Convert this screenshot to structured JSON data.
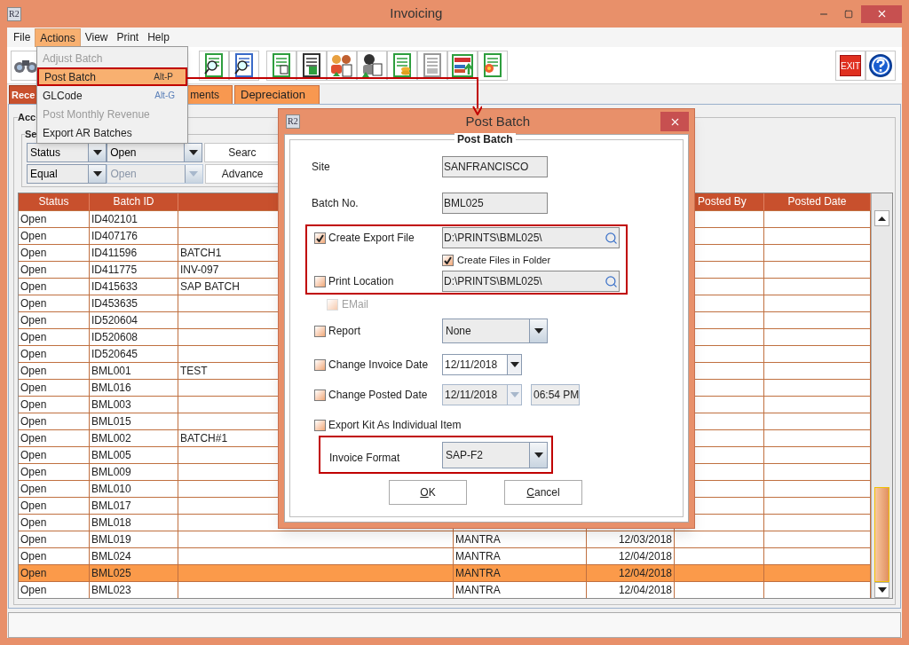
{
  "window": {
    "logo": "R2",
    "title": "Invoicing"
  },
  "menu_bar": [
    {
      "label": "File",
      "selected": false
    },
    {
      "label": "Actions",
      "selected": true
    },
    {
      "label": "View",
      "selected": false
    },
    {
      "label": "Print",
      "selected": false
    },
    {
      "label": "Help",
      "selected": false
    }
  ],
  "actions_menu": [
    {
      "label": "Adjust Batch",
      "disabled": true,
      "selected": false
    },
    {
      "label": "Post Batch",
      "shortcut": "Alt-P",
      "disabled": false,
      "selected": true
    },
    {
      "label": "GLCode",
      "shortcut": "Alt-G",
      "disabled": false,
      "selected": false
    },
    {
      "label": "Post Monthly Revenue",
      "disabled": true,
      "selected": false
    },
    {
      "label": "Export AR Batches",
      "disabled": false,
      "selected": false
    }
  ],
  "toolbar": {
    "exit_label": "EXIT"
  },
  "tabs": [
    {
      "label": "Rece",
      "selected": true
    },
    {
      "label": "ments",
      "selected": false
    },
    {
      "label": "Depreciation",
      "selected": false
    }
  ],
  "group_title": "Acc",
  "search_group": {
    "title": "Se",
    "field": "Status",
    "value": "Open",
    "operator": "Equal",
    "value_2": "Open",
    "value_2_disabled": true,
    "search_button": "Searc",
    "advanced_button": "Advance"
  },
  "table": {
    "header": {
      "status": "Status",
      "batch_id": "Batch ID",
      "posted_by": "Posted By",
      "posted_date": "Posted Date"
    },
    "rows": [
      {
        "status": "Open",
        "batch_id": "ID402101",
        "selected": false
      },
      {
        "status": "Open",
        "batch_id": "ID407176",
        "selected": false
      },
      {
        "status": "Open",
        "batch_id": "ID411596",
        "column_3": "BATCH1",
        "selected": false
      },
      {
        "status": "Open",
        "batch_id": "ID411775",
        "column_3": "INV-097",
        "selected": false
      },
      {
        "status": "Open",
        "batch_id": "ID415633",
        "column_3": "SAP BATCH",
        "selected": false
      },
      {
        "status": "Open",
        "batch_id": "ID453635",
        "selected": false
      },
      {
        "status": "Open",
        "batch_id": "ID520604",
        "selected": false
      },
      {
        "status": "Open",
        "batch_id": "ID520608",
        "selected": false
      },
      {
        "status": "Open",
        "batch_id": "ID520645",
        "selected": false
      },
      {
        "status": "Open",
        "batch_id": "BML001",
        "column_3": "TEST",
        "selected": false
      },
      {
        "status": "Open",
        "batch_id": "BML016",
        "selected": false
      },
      {
        "status": "Open",
        "batch_id": "BML003",
        "selected": false
      },
      {
        "status": "Open",
        "batch_id": "BML015",
        "selected": false
      },
      {
        "status": "Open",
        "batch_id": "BML002",
        "column_3": "BATCH#1",
        "selected": false
      },
      {
        "status": "Open",
        "batch_id": "BML005",
        "selected": false
      },
      {
        "status": "Open",
        "batch_id": "BML009",
        "selected": false
      },
      {
        "status": "Open",
        "batch_id": "BML010",
        "selected": false
      },
      {
        "status": "Open",
        "batch_id": "BML017",
        "selected": false
      },
      {
        "status": "Open",
        "batch_id": "BML018",
        "selected": false
      },
      {
        "status": "Open",
        "batch_id": "BML019",
        "column_4": "MANTRA",
        "column_5": "12/03/2018",
        "selected": false
      },
      {
        "status": "Open",
        "batch_id": "BML024",
        "column_4": "MANTRA",
        "column_5": "12/04/2018",
        "selected": false
      },
      {
        "status": "Open",
        "batch_id": "BML025",
        "column_4": "MANTRA",
        "column_5": "12/04/2018",
        "selected": true
      },
      {
        "status": "Open",
        "batch_id": "BML023",
        "column_4": "MANTRA",
        "column_5": "12/04/2018",
        "selected": false
      }
    ]
  },
  "dialog": {
    "logo": "R2",
    "title": "Post Batch",
    "group_title": "Post Batch",
    "site": {
      "label": "Site",
      "value": "SANFRANCISCO"
    },
    "batch_no": {
      "label": "Batch No.",
      "value": "BML025"
    },
    "export_highlighted": true,
    "create_export_file": {
      "label": "Create Export File",
      "checked": true,
      "path": "D:\\PRINTS\\BML025\\"
    },
    "create_files_in_folder": {
      "label": "Create Files in Folder",
      "checked": true
    },
    "print_location": {
      "label": "Print Location",
      "checked": false,
      "path": "D:\\PRINTS\\BML025\\"
    },
    "email": {
      "label": "EMail",
      "checked": false,
      "disabled": true
    },
    "report": {
      "label": "Report",
      "checked": false,
      "value": "None"
    },
    "change_invoice_date": {
      "label": "Change Invoice Date",
      "checked": false,
      "value": "12/11/2018",
      "disabled": false
    },
    "change_posted_date": {
      "label": "Change Posted Date",
      "checked": false,
      "value": "12/11/2018",
      "time": "06:54 PM",
      "disabled": true
    },
    "export_kit": {
      "label": "Export Kit As Individual Item",
      "checked": false
    },
    "invoice_format": {
      "label": "Invoice Format",
      "value": "SAP-F2",
      "highlighted": true
    },
    "buttons": [
      "OK",
      "Cancel"
    ]
  }
}
